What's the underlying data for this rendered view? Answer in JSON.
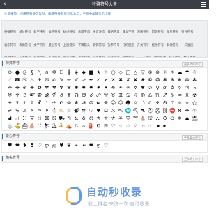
{
  "header": {
    "title": "特殊符号大全"
  },
  "notice": "注意事项：点击符号便可复制；电脑符号有些显示为口，手机中却能显示出来",
  "categories": [
    "特殊符号",
    "单位符号",
    "数字序号",
    "数学符号",
    "标点符号",
    "希腊字母",
    "拼音注音",
    "俄语字母",
    "日文字符",
    "方块符号",
    "箭头符号",
    "星星符号",
    "天气符号",
    "音乐符号",
    "表情符号",
    "文字符号",
    "爱心符号",
    "上涨箭头",
    "下降箭头",
    "装饰符号",
    "货币符号",
    "几何图形",
    "开关符号",
    "框线符号",
    "其他符号",
    "十二星座",
    "麻将符号",
    "扑克符号",
    "数字符号",
    "象棋符号",
    "罗马数字",
    "偏旁部首",
    "注音符号",
    "表情图案",
    "汉字笔画",
    "emoji符号",
    "圆圈数字",
    "韩文字母",
    "繁体字符",
    "藏文符号",
    "蒙文符号"
  ],
  "sections": [
    {
      "title": "特殊符号",
      "more": "更多特殊符号",
      "symbols": [
        "⊙",
        "●",
        "◎",
        "§",
        "╲",
        "∩",
        "Ф",
        "☐",
        "╋",
        "◈",
        "◆",
        "■",
        "★",
        "☆",
        "○",
        "◇",
        "□",
        "△",
        "▽",
        "⊕",
        "⊗",
        "☼",
        "☀",
        "☁",
        "☂",
        "☃",
        "☄",
        "☎",
        "☏",
        "♨",
        "✈",
        "✉",
        "✍",
        "✎",
        "✏",
        "✐",
        "✑",
        "✒",
        "✓",
        "✔",
        "✕",
        "✖",
        "✗",
        "✘",
        "❀",
        "❁",
        "❂",
        "❃",
        "❄",
        "❅",
        "❆",
        "❇",
        "❈",
        "❉",
        "❊",
        "❋",
        "✿",
        "✾",
        "✽",
        "✼",
        "✻",
        "✺",
        "✹",
        "✸",
        "✷",
        "✶",
        "✵",
        "✴",
        "✳",
        "✲",
        "✱",
        "✰",
        "♀",
        "♂",
        "♁",
        "☿",
        "♃",
        "♄",
        "♅",
        "♆",
        "♇",
        "⚤",
        "⚢",
        "⚣",
        "⚥",
        "⚦",
        "⚧",
        "☊",
        "☋",
        "☌",
        "☍",
        "♈",
        "♉",
        "♊",
        "♋",
        "♌",
        "♍",
        "♎",
        "♏",
        "♐",
        "♑",
        "♒",
        "♓",
        "☢",
        "☣",
        "☤",
        "☥",
        "☦",
        "☧",
        "☨",
        "☩",
        "☪",
        "☫",
        "☬",
        "☭",
        "☮",
        "☯",
        "☸",
        "☹",
        "☺",
        "☻",
        "☼",
        "☽",
        "☾",
        "⚘",
        "⚙",
        "⚚",
        "⚛",
        "⚜",
        "⚝",
        "⚞",
        "⚟",
        "⚠",
        "⚡",
        "⚰",
        "⚱",
        "⛄",
        "⛅",
        "⛆",
        "⛇",
        "⛈",
        "⛉",
        "⛊",
        "⛋",
        "⛌",
        "⛍",
        "⛎",
        "⛏",
        "⛐",
        "⛑",
        "⛒",
        "⛓",
        "⛔",
        "⛕",
        "⛖",
        "⛗",
        "⛘",
        "⛙",
        "⛚",
        "⛛",
        "⛜",
        "⛝",
        "⛞",
        "⛟",
        "⛠",
        "⛡",
        "⛢",
        "⛣",
        "⛤",
        "⛥",
        "⛦",
        "⛧",
        "⛨",
        "⛩",
        "⛪",
        "⛫",
        "⛬",
        "⛭",
        "⛮",
        "⛯",
        "⛰",
        "⛱",
        "⛲",
        "⛳",
        "⛴",
        "⛵",
        "⛶",
        "⛷",
        "⛸",
        "⛹",
        "⛺",
        "⛻",
        "⛼",
        "⛽",
        "⛾",
        "⛿",
        "♡",
        "♢",
        "♤",
        "♧",
        "☜",
        "☞",
        "☚",
        "☛"
      ]
    },
    {
      "title": "爱心符号",
      "more": "更多爱心符号",
      "symbols": [
        "♥",
        "❤",
        "❥",
        "❣",
        "♡",
        "ღ",
        "ஐ",
        "♥",
        "❦",
        "❧",
        "☙",
        "❤",
        "ღ",
        "♡"
      ]
    },
    {
      "title": "箭头符号",
      "more": "更多箭头符号",
      "symbols": []
    }
  ],
  "watermark": {
    "brand": "自动秒收录",
    "sub": "收上排名·来访一次·自动收录"
  },
  "colors": {
    "header_bg": "#3b3f45",
    "accent": "#2d6fb4"
  }
}
